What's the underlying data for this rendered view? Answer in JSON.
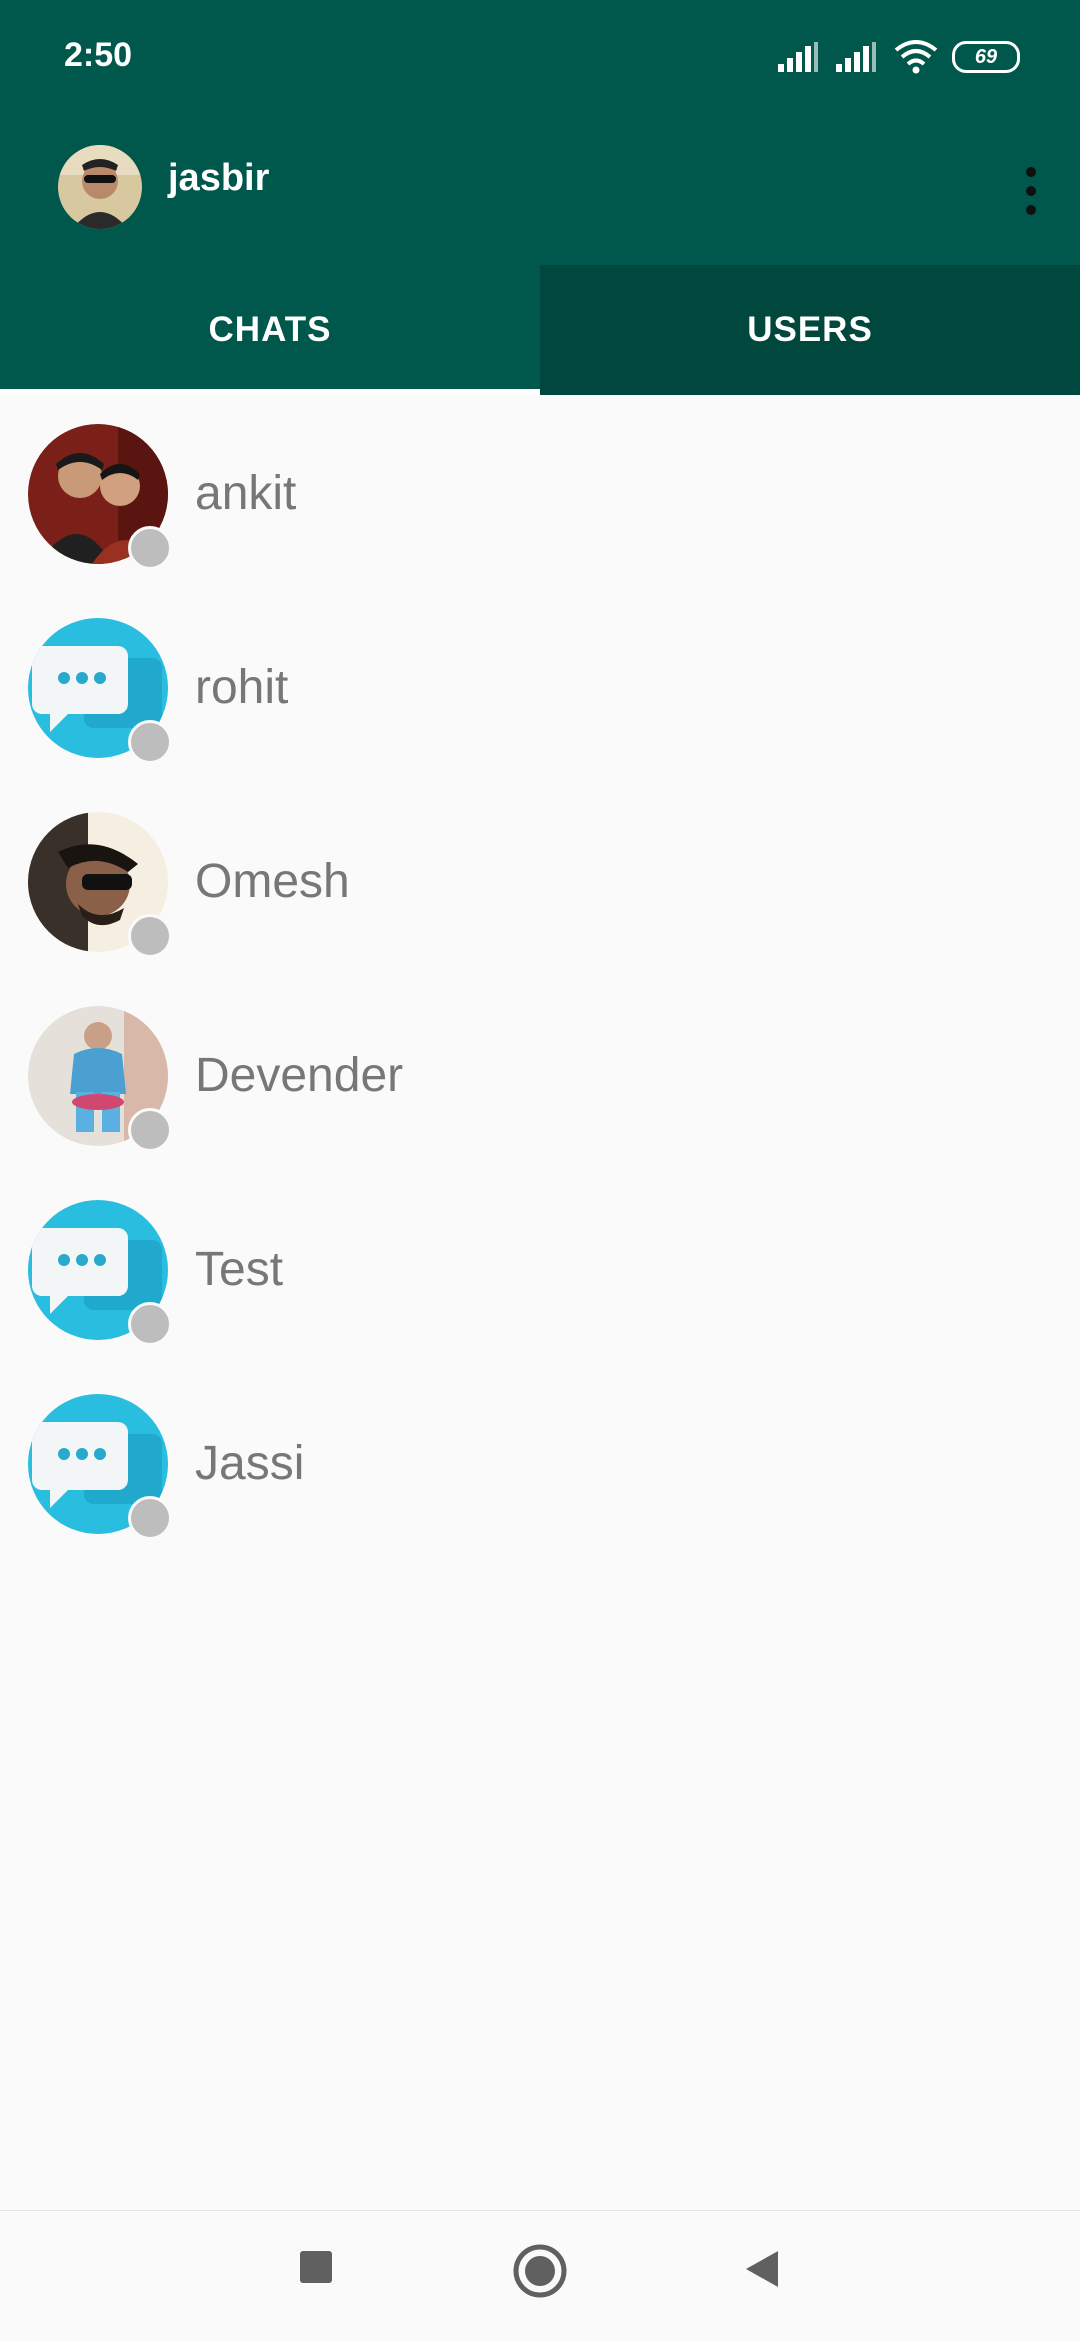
{
  "status_bar": {
    "time": "2:50",
    "battery": "69"
  },
  "app_bar": {
    "username": "jasbir",
    "avatar_icon": "user-photo"
  },
  "tabs": [
    {
      "label": "CHATS",
      "selected": true
    },
    {
      "label": "USERS",
      "selected": false
    }
  ],
  "contacts": [
    {
      "name": "ankit",
      "avatar": "photo",
      "online": false
    },
    {
      "name": "rohit",
      "avatar": "chat-bubble-default",
      "online": false
    },
    {
      "name": "Omesh",
      "avatar": "photo",
      "online": false
    },
    {
      "name": "Devender",
      "avatar": "photo",
      "online": false
    },
    {
      "name": "Test",
      "avatar": "chat-bubble-default",
      "online": false
    },
    {
      "name": "Jassi",
      "avatar": "chat-bubble-default",
      "online": false
    }
  ],
  "colors": {
    "primary": "#00574b",
    "primary_dark": "#00473d",
    "accent_default_avatar": "#29b6d8",
    "presence_offline": "#bdbdbd"
  }
}
